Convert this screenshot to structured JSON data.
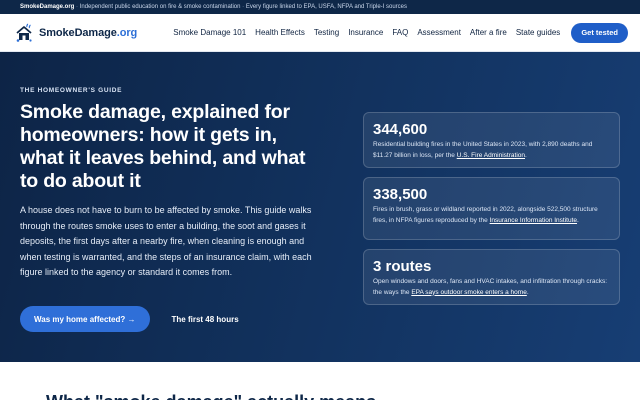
{
  "topbar": {
    "brand": "SmokeDamage.org",
    "tagline": "Independent public education on fire & smoke contamination",
    "sources_note": "Every figure linked to EPA, USFA, NFPA and Triple-I sources"
  },
  "nav": {
    "logo_name": "SmokeDamage",
    "logo_tld": ".org",
    "items": [
      "Smoke Damage 101",
      "Health Effects",
      "Testing",
      "Insurance",
      "FAQ",
      "Assessment",
      "After a fire",
      "State guides"
    ],
    "cta_label": "Get tested"
  },
  "hero": {
    "eyebrow": "THE HOMEOWNER'S GUIDE",
    "headline": "Smoke damage, explained for homeowners: how it gets in, what it leaves behind, and what to do about it",
    "lede": "A house does not have to burn to be affected by smoke. This guide walks through the routes smoke uses to enter a building, the soot and gases it deposits, the first days after a nearby fire, when cleaning is enough and when testing is warranted, and the steps of an insurance claim, with each figure linked to the agency or standard it comes from.",
    "primary_button": "Was my home affected? →",
    "secondary_link": "The first 48 hours"
  },
  "stats": [
    {
      "value": "344,600",
      "text": "Residential building fires in the United States in 2023, with 2,890 deaths and $11.27 billion in loss, per the ",
      "link": "U.S. Fire Administration",
      "after": "."
    },
    {
      "value": "338,500",
      "text": "Fires in brush, grass or wildland reported in 2022, alongside 522,500 structure fires, in NFPA figures reproduced by the ",
      "link": "Insurance Information Institute",
      "after": "."
    },
    {
      "value": "3 routes",
      "text": "Open windows and doors, fans and HVAC intakes, and infiltration through cracks: the ways the ",
      "link": "EPA says outdoor smoke enters a home",
      "after": "."
    }
  ],
  "below": {
    "heading": "What \"smoke damage\" actually means"
  }
}
